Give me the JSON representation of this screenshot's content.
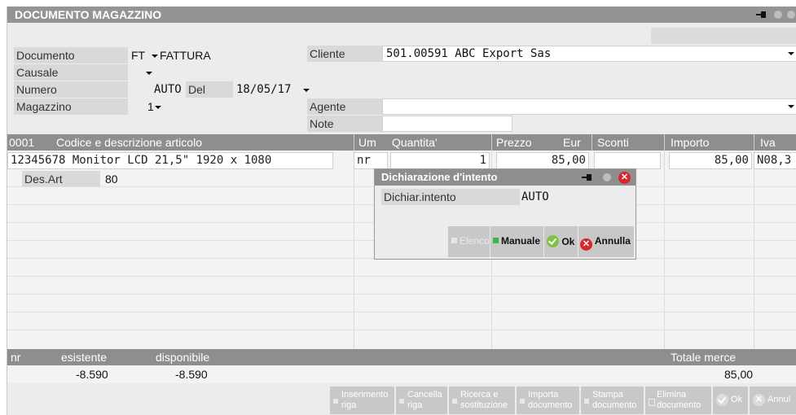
{
  "window": {
    "title": "DOCUMENTO MAGAZZINO"
  },
  "form": {
    "documento_label": "Documento",
    "documento_code": "FT",
    "documento_desc": "FATTURA",
    "causale_label": "Causale",
    "numero_label": "Numero",
    "numero_value": "AUTO",
    "del_label": "Del",
    "del_value": "18/05/17",
    "magazzino_label": "Magazzino",
    "magazzino_value": "1",
    "cliente_label": "Cliente",
    "cliente_value": "501.00591 ABC Export Sas",
    "agente_label": "Agente",
    "note_label": "Note"
  },
  "grid": {
    "columns": [
      "0001",
      "Codice e descrizione articolo",
      "Um",
      "Quantita'",
      "Prezzo",
      "Eur",
      "Sconti",
      "Importo",
      "Iva"
    ],
    "row": {
      "codice": "12345678 Monitor LCD 21,5\" 1920 x 1080",
      "um": "nr",
      "quantita": "1",
      "prezzo": "85,00",
      "sconti": "",
      "importo": "85,00",
      "iva": "N08,3"
    },
    "desart_label": "Des.Art",
    "desart_value": "80"
  },
  "dialog": {
    "title": "Dichiarazione d'intento",
    "field_label": "Dichiar.intento",
    "field_value": "AUTO",
    "buttons": {
      "elenco": "Elenco",
      "manuale": "Manuale",
      "ok": "Ok",
      "annulla": "Annulla"
    }
  },
  "footer": {
    "um": "nr",
    "esistente_label": "esistente",
    "disponibile_label": "disponibile",
    "totale_label": "Totale merce",
    "esistente_value": "-8.590",
    "disponibile_value": "-8.590",
    "totale_value": "85,00"
  },
  "toolbar": {
    "inserimento_1": "Inserimento",
    "inserimento_2": "riga",
    "cancella_1": "Cancella",
    "cancella_2": "riga",
    "ricerca_1": "Ricerca e",
    "ricerca_2": "sostituzione",
    "importa_1": "Importa",
    "importa_2": "documento",
    "stampa_1": "Stampa",
    "stampa_2": "documento",
    "elimina_1": "Elimina",
    "elimina_2": "documento",
    "ok": "Ok",
    "annulla": "Annul"
  },
  "colors": {
    "title_bg": "#949494",
    "header_bg": "#8e8e8e",
    "ok_green": "#7dc242",
    "cancel_red": "#d9262c"
  }
}
